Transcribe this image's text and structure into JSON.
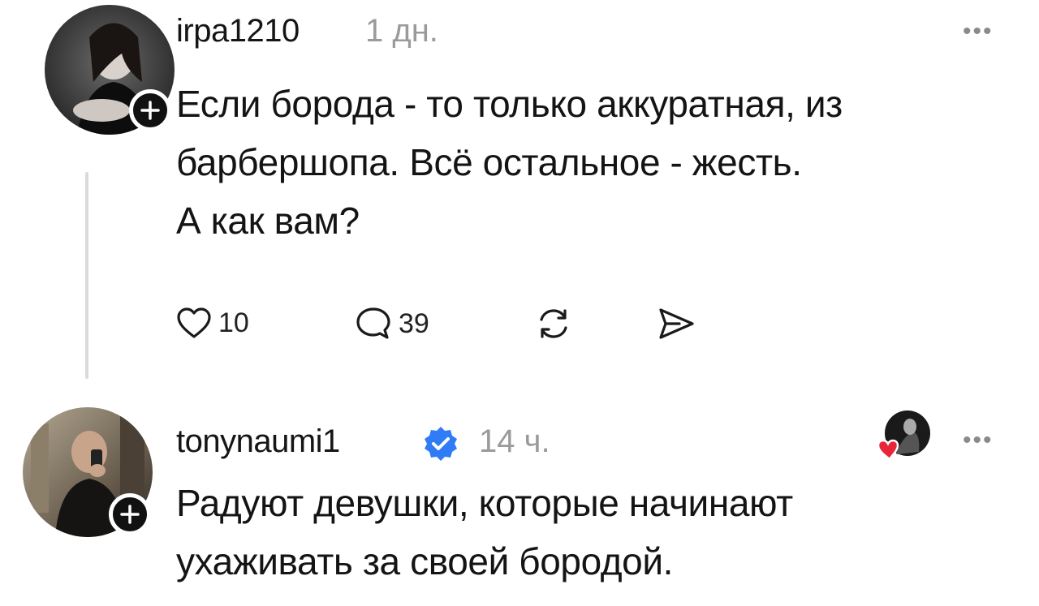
{
  "posts": [
    {
      "username": "irpa1210",
      "time": "1 дн.",
      "more": "•••",
      "text_lines": [
        "Если борода -  то только аккуратная, из",
        "барбершопа. Всё остальное - жесть.",
        "А как вам?"
      ],
      "likes": "10",
      "replies": "39",
      "icons": [
        "heart-icon",
        "comment-icon",
        "repost-icon",
        "share-icon"
      ]
    },
    {
      "username": "tonynaumi1",
      "verified": true,
      "time": "14 ч.",
      "more": "•••",
      "text_lines": [
        "Радуют девушки, которые начинают",
        "ухаживать за своей бородой."
      ]
    }
  ],
  "colors": {
    "verified": "#2f7cf6",
    "heart": "#e8263b",
    "muted": "#9a9a9a"
  }
}
